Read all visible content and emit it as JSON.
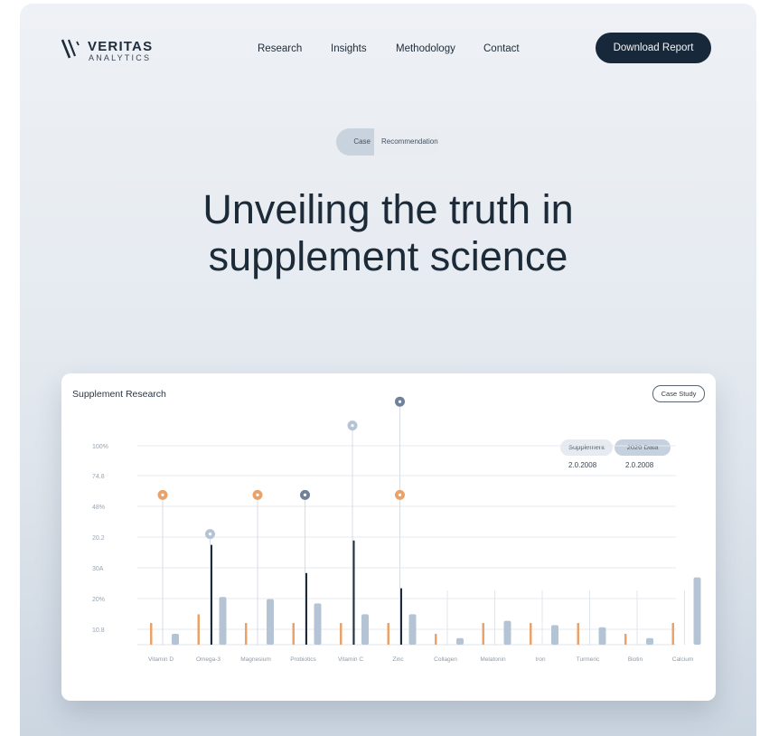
{
  "brand": {
    "name": "VERITAS",
    "sub": "ANALYTICS"
  },
  "nav": [
    {
      "label": "Research"
    },
    {
      "label": "Insights"
    },
    {
      "label": "Methodology"
    },
    {
      "label": "Contact"
    }
  ],
  "cta": {
    "label": "Download Report"
  },
  "pill": {
    "left": "Case",
    "right": "Recommendation"
  },
  "hero": {
    "line1": "Unveiling the truth in",
    "line2": "supplement science"
  },
  "card": {
    "title": "Supplement Research",
    "button": "Case Study",
    "legend": {
      "items": [
        "Supplement",
        "2020 Data"
      ],
      "values": [
        "2.0.2008",
        "2.0.2008"
      ]
    }
  },
  "colors": {
    "navy": "#17283a",
    "orange": "#e9a36a",
    "steel": "#b5c4d4",
    "dark_bar": "#1c2a3a",
    "slate_marker": "#6f819b"
  },
  "chart_data": {
    "type": "bar",
    "ylabel_ticks": [
      "100%",
      "74.8",
      "48%",
      "20.2",
      "30A",
      "20%",
      "10.8"
    ],
    "categories": [
      "Vitamin D",
      "Omega-3",
      "Magnesium",
      "Probiotics",
      "Vitamin C",
      "Zinc",
      "Collagen",
      "Melatonin",
      "Iron",
      "Turmeric",
      "Biotin",
      "Calcium"
    ],
    "series": [
      {
        "values": [
          10,
          14,
          10,
          10,
          10,
          10,
          5,
          10,
          10,
          10,
          5,
          10
        ]
      },
      {
        "values": [
          0,
          46,
          0,
          33,
          48,
          26,
          0,
          0,
          0,
          0,
          0,
          0
        ]
      },
      {
        "values": [
          5,
          22,
          21,
          19,
          14,
          14,
          3,
          11,
          9,
          8,
          3,
          31
        ]
      }
    ],
    "markers": [
      {
        "category": "Vitamin D",
        "level": 69,
        "tone": "orange"
      },
      {
        "category": "Omega-3",
        "level": 51,
        "tone": "steel"
      },
      {
        "category": "Magnesium",
        "level": 69,
        "tone": "orange"
      },
      {
        "category": "Probiotics",
        "level": 69,
        "tone": "slate"
      },
      {
        "category": "Vitamin C",
        "level": 101,
        "tone": "steel"
      },
      {
        "category": "Zinc",
        "level": 112,
        "tone": "slate"
      },
      {
        "category": "Zinc",
        "level": 69,
        "tone": "orange"
      }
    ],
    "grid": true
  }
}
